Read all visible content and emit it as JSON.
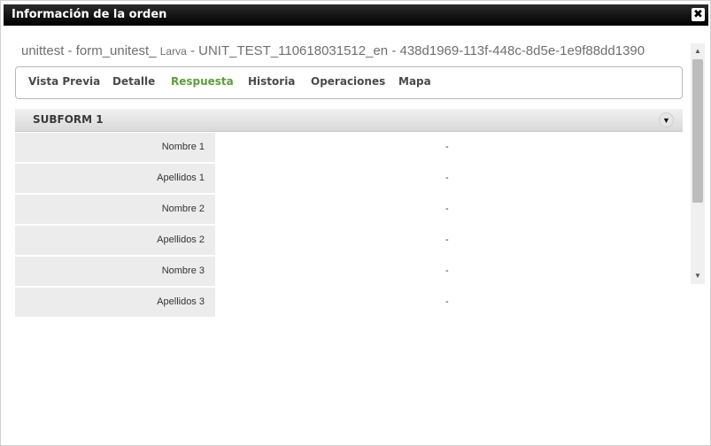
{
  "window": {
    "title": "Información de la orden",
    "close_glyph": "✖"
  },
  "order": {
    "prefix": "unittest - form_unitest_ ",
    "subject": "Larva",
    "id_text": " - UNIT_TEST_110618031512_en - 438d1969-113f-448c-8d5e-1e9f88dd1390"
  },
  "tabs": [
    {
      "label": "Vista Previa",
      "active": false
    },
    {
      "label": "Detalle",
      "active": false
    },
    {
      "label": "Respuesta",
      "active": true
    },
    {
      "label": "Historia",
      "active": false
    },
    {
      "label": "Operaciones",
      "active": false
    },
    {
      "label": "Mapa",
      "active": false
    }
  ],
  "section": {
    "title": "SUBFORM 1",
    "toggle_icon": "collapse-arrow-icon"
  },
  "fields": [
    {
      "label": "Nombre 1",
      "value": "-"
    },
    {
      "label": "Apellidos 1",
      "value": "-"
    },
    {
      "label": "Nombre 2",
      "value": "-"
    },
    {
      "label": "Apellidos 2",
      "value": "-"
    },
    {
      "label": "Nombre 3",
      "value": "-"
    },
    {
      "label": "Apellidos 3",
      "value": "-"
    }
  ],
  "colors": {
    "active_tab": "#5a9e3a",
    "titlebar": "#000000"
  }
}
